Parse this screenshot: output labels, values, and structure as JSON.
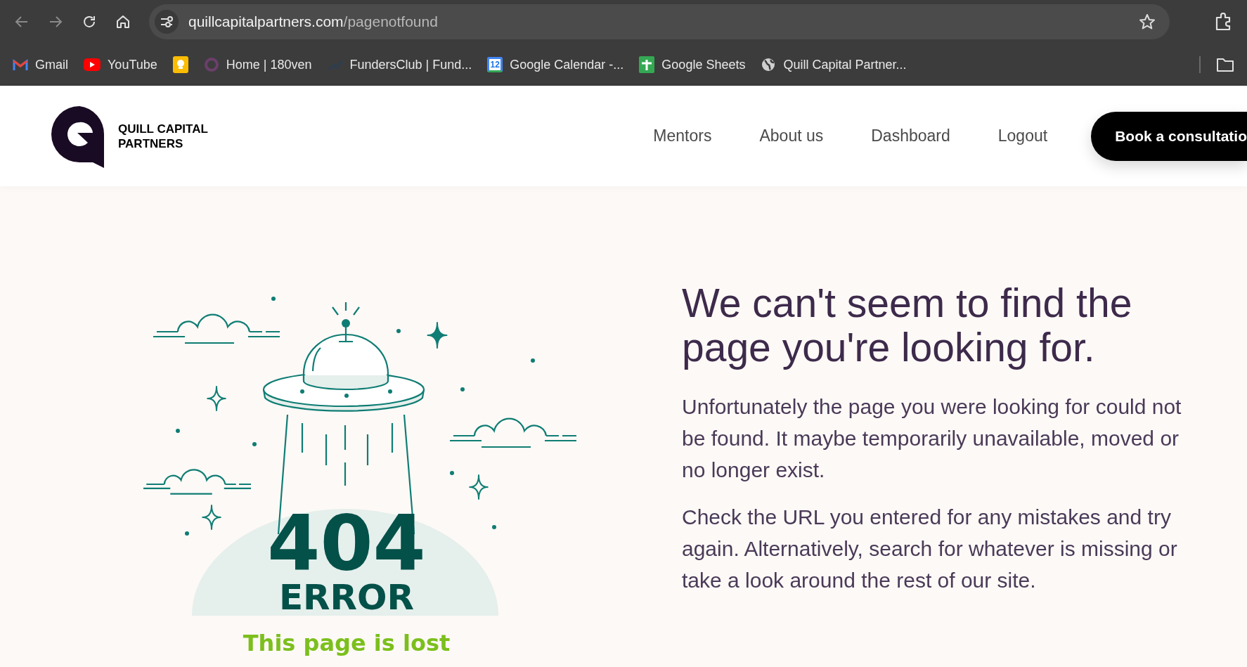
{
  "browser": {
    "url": {
      "domain": "quillcapitalpartners.com",
      "path": "/pagenotfound"
    },
    "bookmarks": [
      {
        "kind": "mail",
        "label": "Gmail"
      },
      {
        "kind": "play",
        "label": "YouTube"
      },
      {
        "kind": "bulb"
      },
      {
        "kind": "ring",
        "label": "Home | 180ven"
      },
      {
        "kind": "wave",
        "label": "FundersClub | Fund..."
      },
      {
        "kind": "calendar",
        "label": "Google Calendar -...",
        "badge": "12"
      },
      {
        "kind": "sheet",
        "label": "Google Sheets"
      },
      {
        "kind": "globe",
        "label": "Quill Capital Partner..."
      }
    ]
  },
  "header": {
    "logo_lines": [
      "QUILL CAPITAL",
      "PARTNERS"
    ],
    "nav": [
      "Mentors",
      "About us",
      "Dashboard",
      "Logout"
    ],
    "cta": "Book a consultatio"
  },
  "main": {
    "illustration": {
      "code": "404",
      "label": "ERROR",
      "caption": "This page is lost"
    },
    "heading": "We can't seem to find the page you're looking for.",
    "paragraphs": [
      "Unfortunately the page you were looking for could not be found. It maybe temporarily unavailable, moved or no longer exist.",
      "Check the URL you entered for any mistakes and try again. Alternatively, search for whatever is missing or take a look around the rest of our site."
    ]
  }
}
